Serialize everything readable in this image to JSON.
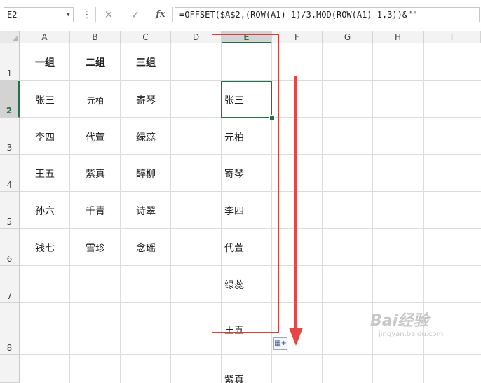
{
  "formula_bar": {
    "name_box": "E2",
    "formula": "=OFFSET($A$2,(ROW(A1)-1)/3,MOD(ROW(A1)-1,3))&\"\"",
    "cancel_icon": "close-icon",
    "confirm_icon": "checkmark-icon",
    "fx_label": "fx"
  },
  "columns": [
    "A",
    "B",
    "C",
    "D",
    "E",
    "F",
    "G",
    "H",
    "I"
  ],
  "rows": [
    "1",
    "2",
    "3",
    "4",
    "5",
    "6",
    "7",
    "8"
  ],
  "selected_column": "E",
  "selected_row": "2",
  "table": {
    "headers": [
      "一组",
      "二组",
      "三组"
    ],
    "data": [
      [
        "张三",
        "元柏",
        "寄琴"
      ],
      [
        "李四",
        "代萱",
        "绿蕊"
      ],
      [
        "王五",
        "紫真",
        "醉柳"
      ],
      [
        "孙六",
        "千青",
        "诗翠"
      ],
      [
        "钱七",
        "雪珍",
        "念瑶"
      ]
    ]
  },
  "column_e": [
    "张三",
    "元柏",
    "寄琴",
    "李四",
    "代萱",
    "绿蕊",
    "王五",
    "紫真"
  ],
  "annotation_color": "#e03b3b",
  "selection_color": "#217346",
  "watermark": {
    "main": "Bai",
    "brand": "经验",
    "sub": "jingyan.baidu.com"
  }
}
